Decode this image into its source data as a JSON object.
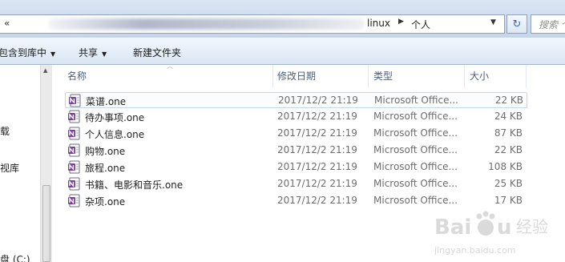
{
  "address_bar": {
    "back_glyph": "«",
    "crumbs": [
      "linux",
      "个人"
    ],
    "crumb_separator": "▶",
    "dropdown_glyph": "▼",
    "refresh_glyph": "↻",
    "search_placeholder": "搜索 个人"
  },
  "toolbar": {
    "include_in_library": "包含到库中",
    "share": "共享",
    "new_folder": "新建文件夹",
    "caret": "▼"
  },
  "nav_pane": {
    "items": [
      "载",
      "视库",
      "盘 (C:)"
    ]
  },
  "columns": {
    "name": "名称",
    "date": "修改日期",
    "type": "类型",
    "size": "大小"
  },
  "files": [
    {
      "name": "菜谱.one",
      "date": "2017/12/2 21:19",
      "type": "Microsoft Office...",
      "size": "22 KB"
    },
    {
      "name": "待办事项.one",
      "date": "2017/12/2 21:19",
      "type": "Microsoft Office...",
      "size": "24 KB"
    },
    {
      "name": "个人信息.one",
      "date": "2017/12/2 21:19",
      "type": "Microsoft Office...",
      "size": "87 KB"
    },
    {
      "name": "购物.one",
      "date": "2017/12/2 21:19",
      "type": "Microsoft Office...",
      "size": "22 KB"
    },
    {
      "name": "旅程.one",
      "date": "2017/12/2 21:19",
      "type": "Microsoft Office...",
      "size": "108 KB"
    },
    {
      "name": "书籍、电影和音乐.one",
      "date": "2017/12/2 21:19",
      "type": "Microsoft Office...",
      "size": "25 KB"
    },
    {
      "name": "杂项.one",
      "date": "2017/12/2 21:19",
      "type": "Microsoft Office...",
      "size": "17 KB"
    }
  ],
  "file_icon": "onenote-file-icon",
  "watermark": {
    "brand": "Baidu经验",
    "url": "jingyan.baidu.com"
  },
  "colors": {
    "accent": "#3a6aa8",
    "onenote_purple": "#7a3e9d",
    "header_text": "#4c607a"
  }
}
